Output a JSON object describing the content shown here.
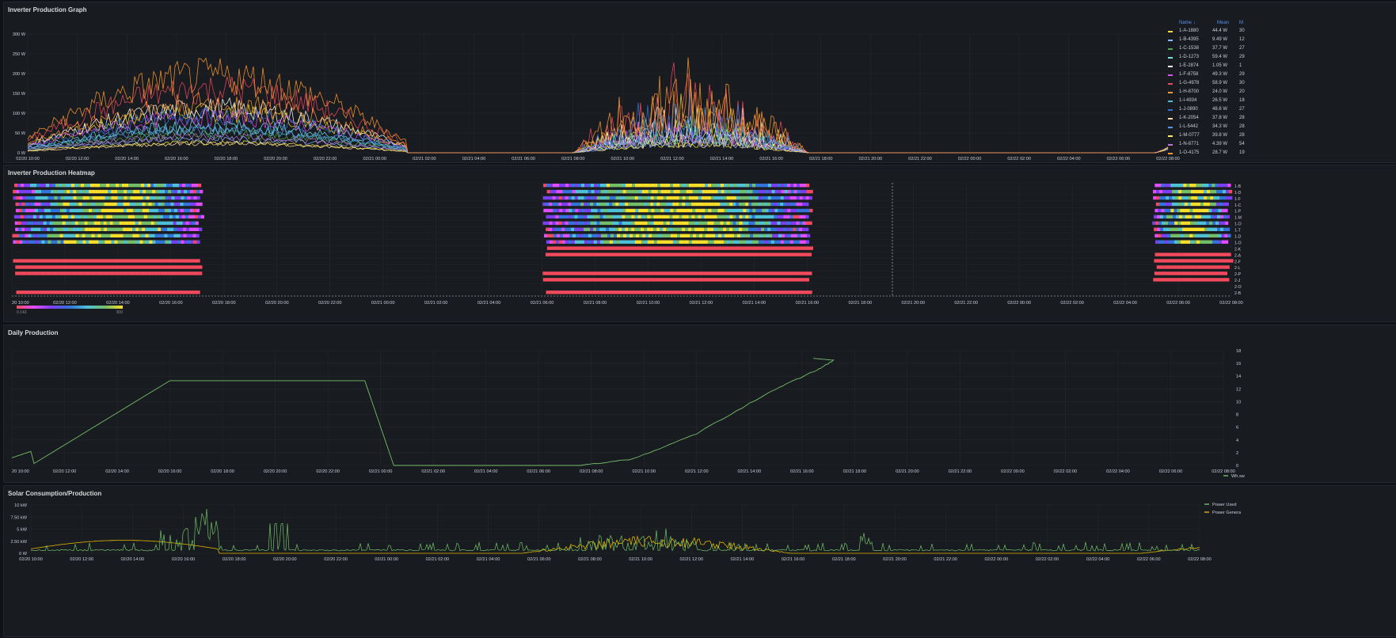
{
  "colors": {
    "bg": "#111217",
    "panel": "#181b1f",
    "grid": "#25282e",
    "text": "#ccccdc",
    "accent": "#5794f2",
    "daily": "#73bf69",
    "power_used": "#73bf69",
    "power_generated": "#e0b400"
  },
  "panels": {
    "graph": {
      "title": "Inverter Production Graph"
    },
    "heatmap": {
      "title": "Inverter Production Heatmap",
      "scale_min": "0.143",
      "scale_max": "300"
    },
    "daily": {
      "title": "Daily Production"
    },
    "solar": {
      "title": "Solar Consumption/Production"
    }
  },
  "legend": {
    "headers": {
      "name": "Name ↓",
      "mean": "Mean",
      "max": "M"
    },
    "rows": [
      {
        "name": "1-A-1880",
        "mean": "44.4 W",
        "max": "30",
        "color": "#fade2a"
      },
      {
        "name": "1-B-4395",
        "mean": "9.49 W",
        "max": "12",
        "color": "#8ab8ff"
      },
      {
        "name": "1-C-1538",
        "mean": "37.7 W",
        "max": "27",
        "color": "#56a64b"
      },
      {
        "name": "1-D-1273",
        "mean": "59.4 W",
        "max": "29",
        "color": "#73e2e7"
      },
      {
        "name": "1-E-2874",
        "mean": "1.05 W",
        "max": "1",
        "color": "#ffffff"
      },
      {
        "name": "1-F-8758",
        "mean": "49.3 W",
        "max": "29",
        "color": "#e04dff"
      },
      {
        "name": "1-G-4978",
        "mean": "58.9 W",
        "max": "30",
        "color": "#f2495c"
      },
      {
        "name": "1-H-8700",
        "mean": "24.0 W",
        "max": "20",
        "color": "#ff9830"
      },
      {
        "name": "1-I-4934",
        "mean": "26.5 W",
        "max": "18",
        "color": "#4ec1d6"
      },
      {
        "name": "1-J-0890",
        "mean": "48.6 W",
        "max": "27",
        "color": "#3274d9"
      },
      {
        "name": "1-K-2054",
        "mean": "37.8 W",
        "max": "28",
        "color": "#ffd6a6"
      },
      {
        "name": "1-L-5442",
        "mean": "34.3 W",
        "max": "28",
        "color": "#5794f2"
      },
      {
        "name": "1-M-0777",
        "mean": "39.8 W",
        "max": "28",
        "color": "#ffee52"
      },
      {
        "name": "1-N-8771",
        "mean": "4.39 W",
        "max": "54",
        "color": "#b877d9"
      },
      {
        "name": "1-O-4175",
        "mean": "28.7 W",
        "max": "19",
        "color": "#ff9830"
      }
    ]
  },
  "graph_axis": {
    "y": [
      "300 W",
      "250 W",
      "200 W",
      "150 W",
      "100 W",
      "50 W",
      "0 W"
    ],
    "x": [
      "02/20 10:00",
      "02/20 12:00",
      "02/20 14:00",
      "02/20 16:00",
      "02/20 18:00",
      "02/20 20:00",
      "02/20 22:00",
      "02/21 00:00",
      "02/21 02:00",
      "02/21 04:00",
      "02/21 06:00",
      "02/21 08:00",
      "02/21 10:00",
      "02/21 12:00",
      "02/21 14:00",
      "02/21 16:00",
      "02/21 18:00",
      "02/21 20:00",
      "02/21 22:00",
      "02/22 00:00",
      "02/22 02:00",
      "02/22 04:00",
      "02/22 06:00",
      "02/22 08:00"
    ]
  },
  "heatmap_axis": {
    "x": [
      "20 10:00",
      "02/20 12:00",
      "02/20 14:00",
      "02/20 16:00",
      "02/20 18:00",
      "02/20 20:00",
      "02/20 22:00",
      "02/21 00:00",
      "02/21 02:00",
      "02/21 04:00",
      "02/21 06:00",
      "02/21 08:00",
      "02/21 10:00",
      "02/21 12:00",
      "02/21 14:00",
      "02/21 16:00",
      "02/21 18:00",
      "02/21 20:00",
      "02/21 22:00",
      "02/22 00:00",
      "02/22 02:00",
      "02/22 04:00",
      "02/22 06:00",
      "02/22 08:00"
    ],
    "rows": [
      "1-B",
      "1-D",
      "1-F",
      "1-C",
      "1-P",
      "1-M",
      "1-O",
      "1-T",
      "1-D",
      "1-O",
      "2-K",
      "2-A",
      "2-F",
      "2-L",
      "2-P",
      "2-J",
      "2-O",
      "2-B"
    ]
  },
  "daily_axis": {
    "x": [
      "20 10:00",
      "02/20 12:00",
      "02/20 14:00",
      "02/20 16:00",
      "02/20 18:00",
      "02/20 20:00",
      "02/20 22:00",
      "02/21 00:00",
      "02/21 02:00",
      "02/21 04:00",
      "02/21 06:00",
      "02/21 08:00",
      "02/21 10:00",
      "02/21 12:00",
      "02/21 14:00",
      "02/21 16:00",
      "02/21 18:00",
      "02/21 20:00",
      "02/21 22:00",
      "02/22 00:00",
      "02/22 02:00",
      "02/22 04:00",
      "02/22 06:00",
      "02/22 08:00"
    ],
    "y": [
      "18",
      "16",
      "14",
      "12",
      "10",
      "8",
      "6",
      "4",
      "2",
      "0"
    ],
    "legend": "Wh.sw"
  },
  "solar_axis": {
    "y": [
      "10 kW",
      "7.50 kW",
      "5 kW",
      "2.50 kW",
      "0 W"
    ],
    "x": [
      "02/20 10:00",
      "02/20 12:00",
      "02/20 14:00",
      "02/20 16:00",
      "02/20 18:00",
      "02/20 20:00",
      "02/20 22:00",
      "02/21 00:00",
      "02/21 02:00",
      "02/21 04:00",
      "02/21 06:00",
      "02/21 08:00",
      "02/21 10:00",
      "02/21 12:00",
      "02/21 14:00",
      "02/21 16:00",
      "02/21 18:00",
      "02/21 20:00",
      "02/21 22:00",
      "02/22 00:00",
      "02/22 02:00",
      "02/22 04:00",
      "02/22 06:00",
      "02/22 08:00"
    ],
    "legend": [
      {
        "name": "Power Used",
        "color": "#73bf69"
      },
      {
        "name": "Power Genera",
        "color": "#e0b400"
      }
    ]
  }
}
